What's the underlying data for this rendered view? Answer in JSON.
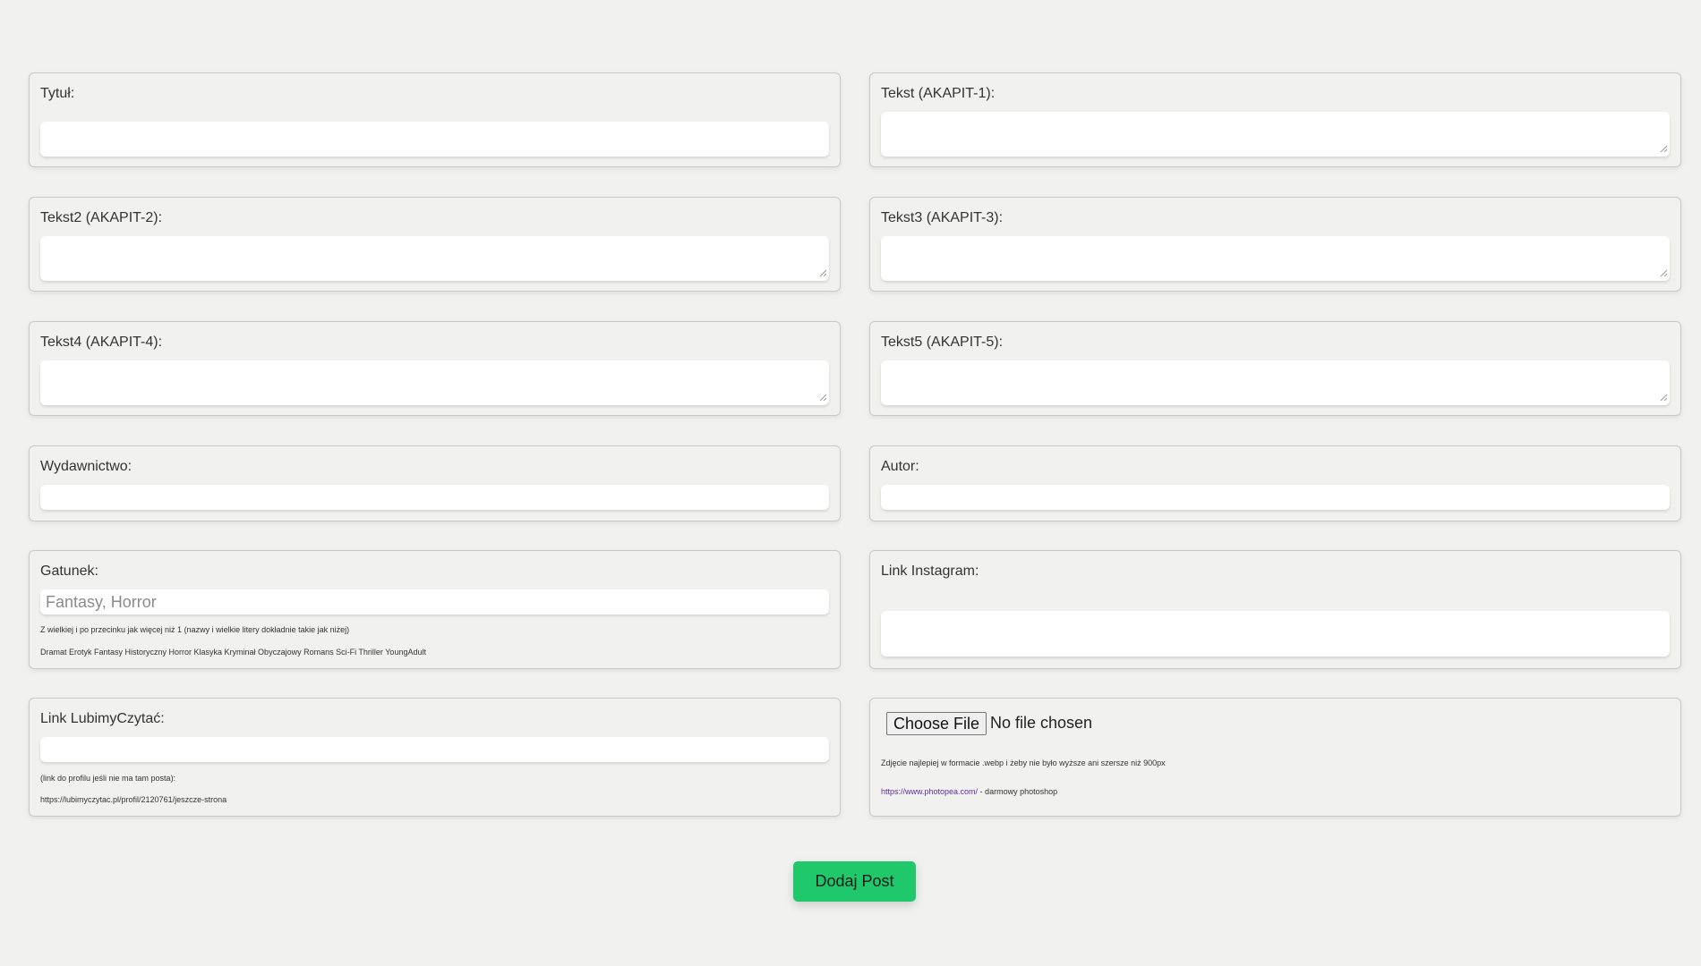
{
  "form": {
    "title": {
      "label": "Tytuł:",
      "value": ""
    },
    "text1": {
      "label": "Tekst (AKAPIT-1):",
      "value": ""
    },
    "text2": {
      "label": "Tekst2 (AKAPIT-2):",
      "value": ""
    },
    "text3": {
      "label": "Tekst3 (AKAPIT-3):",
      "value": ""
    },
    "text4": {
      "label": "Tekst4 (AKAPIT-4):",
      "value": ""
    },
    "text5": {
      "label": "Tekst5 (AKAPIT-5):",
      "value": ""
    },
    "publisher": {
      "label": "Wydawnictwo:",
      "value": ""
    },
    "author": {
      "label": "Autor:",
      "value": ""
    },
    "genre": {
      "label": "Gatunek:",
      "placeholder": "Fantasy, Horror",
      "hint": "Z wielkiej i po przecinku jak więcej niż 1 (nazwy i wielkie litery dokładnie takie jak niżej)",
      "options_text": "Dramat Erotyk Fantasy Historyczny Horror Klasyka Kryminał Obyczajowy Romans Sci-Fi Thriller YoungAdult"
    },
    "instagram": {
      "label": "Link Instagram:",
      "value": ""
    },
    "lubimyczytac": {
      "label": "Link LubimyCzytać:",
      "hint": "(link do profilu jeśli nie ma tam posta):",
      "example": "https://lubimyczytac.pl/profil/2120761/jeszcze-strona"
    },
    "image": {
      "button_label": "Choose File",
      "status": "No file chosen",
      "hint": "Zdjęcie najlepiej w formacie .webp i żeby nie było wyższe ani szersze niż 900px",
      "link_text": "https://www.photopea.com/",
      "link_suffix": " - darmowy photoshop"
    },
    "submit_label": "Dodaj Post"
  },
  "colors": {
    "background": "#f1f1ef",
    "submit": "#1fc96b",
    "link": "#5f2ea0"
  }
}
